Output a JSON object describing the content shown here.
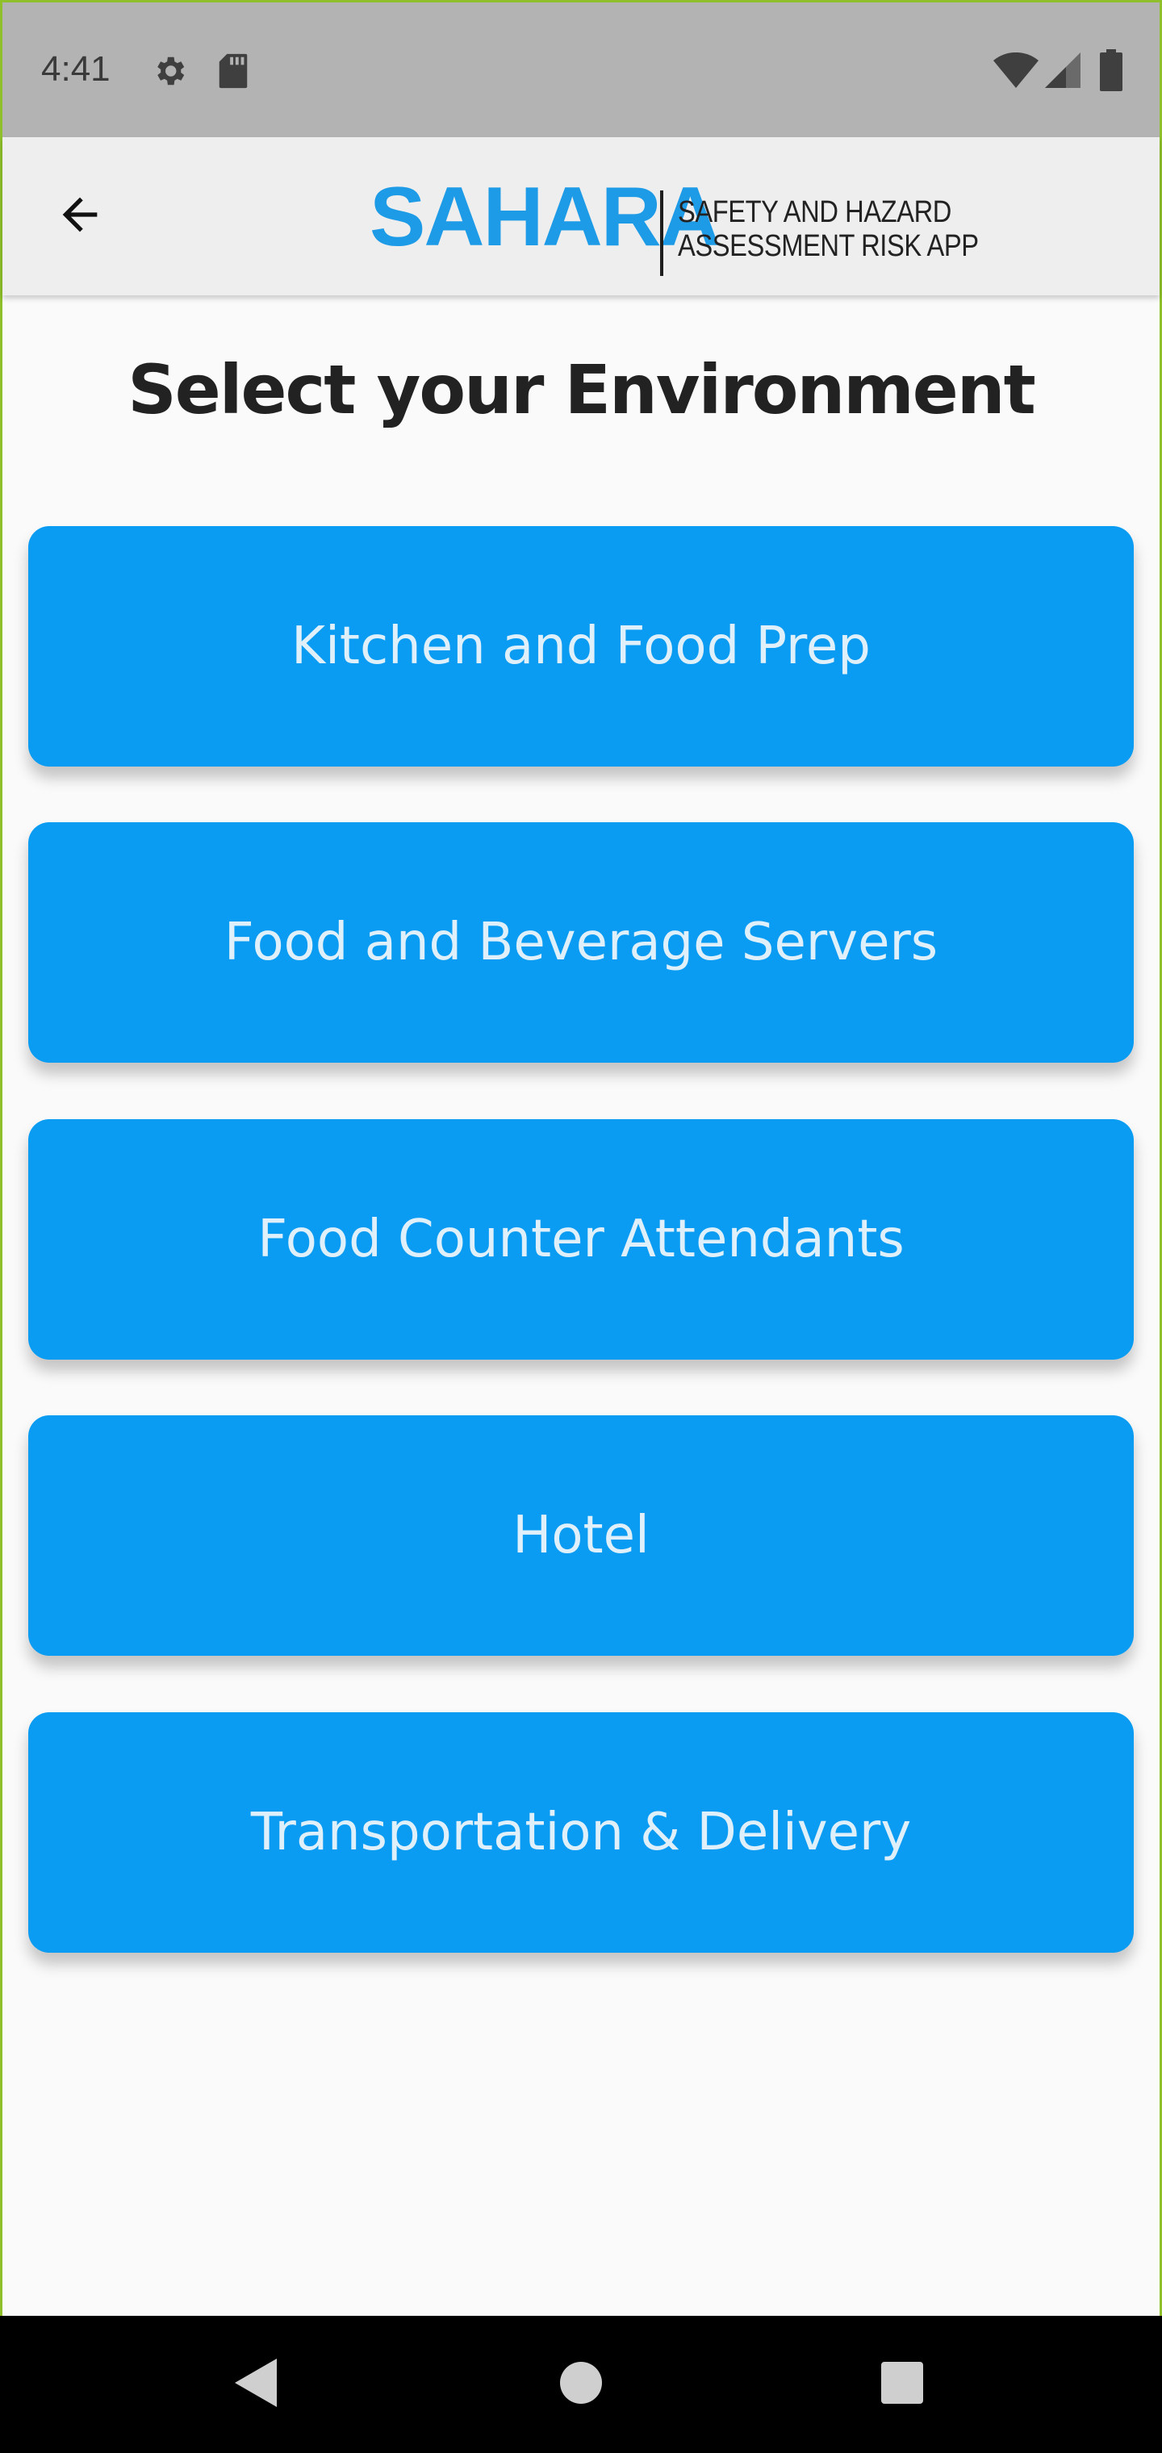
{
  "status_bar": {
    "time": "4:41",
    "icons": [
      "gear-icon",
      "sd-card-icon",
      "wifi-icon",
      "signal-icon",
      "battery-icon"
    ]
  },
  "app_bar": {
    "back_icon": "arrow-left-icon",
    "logo": {
      "wordmark": "SAHARA",
      "tagline_line1": "SAFETY AND HAZARD",
      "tagline_line2": "ASSESSMENT RISK APP"
    }
  },
  "main": {
    "title": "Select your Environment",
    "environments": [
      {
        "label": "Kitchen and Food Prep"
      },
      {
        "label": "Food and Beverage Servers"
      },
      {
        "label": "Food Counter Attendants"
      },
      {
        "label": "Hotel"
      },
      {
        "label": "Transportation & Delivery"
      }
    ]
  },
  "nav_bar": {
    "icons": [
      "back-triangle-icon",
      "home-circle-icon",
      "recents-square-icon"
    ]
  },
  "colors": {
    "accent": "#0a9cf2",
    "logo_blue": "#1e9be6",
    "status_bar_bg": "#b3b3b3",
    "app_bar_bg": "#eeeeee",
    "background": "#fafafa",
    "button_text": "#dff0fb",
    "frame_border": "#8fbf2a"
  }
}
